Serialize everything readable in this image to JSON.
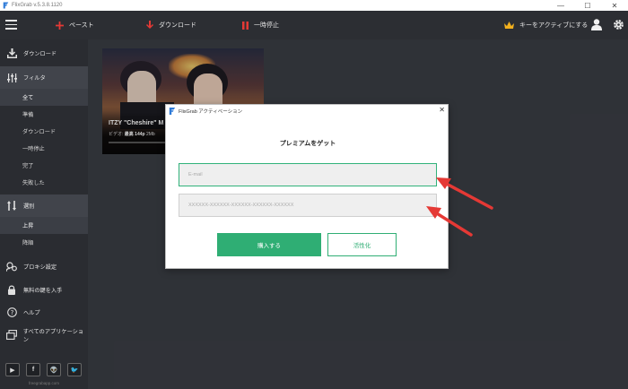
{
  "window": {
    "title": "FlixGrab  v.5.3.8.1120",
    "controls": {
      "minimize": "—",
      "maximize": "☐",
      "close": "✕"
    }
  },
  "toolbar": {
    "paste_label": "ペースト",
    "download_label": "ダウンロード",
    "pause_label": "一時停止",
    "activate_label": "キーをアクティブにする"
  },
  "sidebar": {
    "download": "ダウンロード",
    "filter": "フィルタ",
    "filters": [
      "全て",
      "準備",
      "ダウンロード",
      "一時停止",
      "完了",
      "失敗した"
    ],
    "sort": "選別",
    "sorts": [
      "上昇",
      "降順"
    ],
    "proxy": "プロキシ設定",
    "free_key": "無料の鍵を入手",
    "help": "ヘルプ",
    "all_apps": "すべてのアプリケーション",
    "social": [
      "▶",
      "f",
      "👽",
      "🐦"
    ],
    "site": "freegrabapp.com"
  },
  "video": {
    "title": "ITZY \"Cheshire\" M",
    "meta_label": "ビデオ:",
    "meta_value": "最高 144p",
    "meta_size": "2Mb"
  },
  "dialog": {
    "title": "FlixGrab アクティベーション",
    "close": "✕",
    "heading": "プレミアムをゲット",
    "email_placeholder": "E-mail",
    "key_placeholder": "XXXXXX-XXXXXX-XXXXXX-XXXXXX-XXXXXX",
    "buy_label": "購入する",
    "activate_label": "活性化"
  },
  "colors": {
    "accent_green": "#2fae74",
    "paste_red": "#e53935",
    "annotation_red": "#e53935",
    "crown_gold": "#f2b01e"
  }
}
